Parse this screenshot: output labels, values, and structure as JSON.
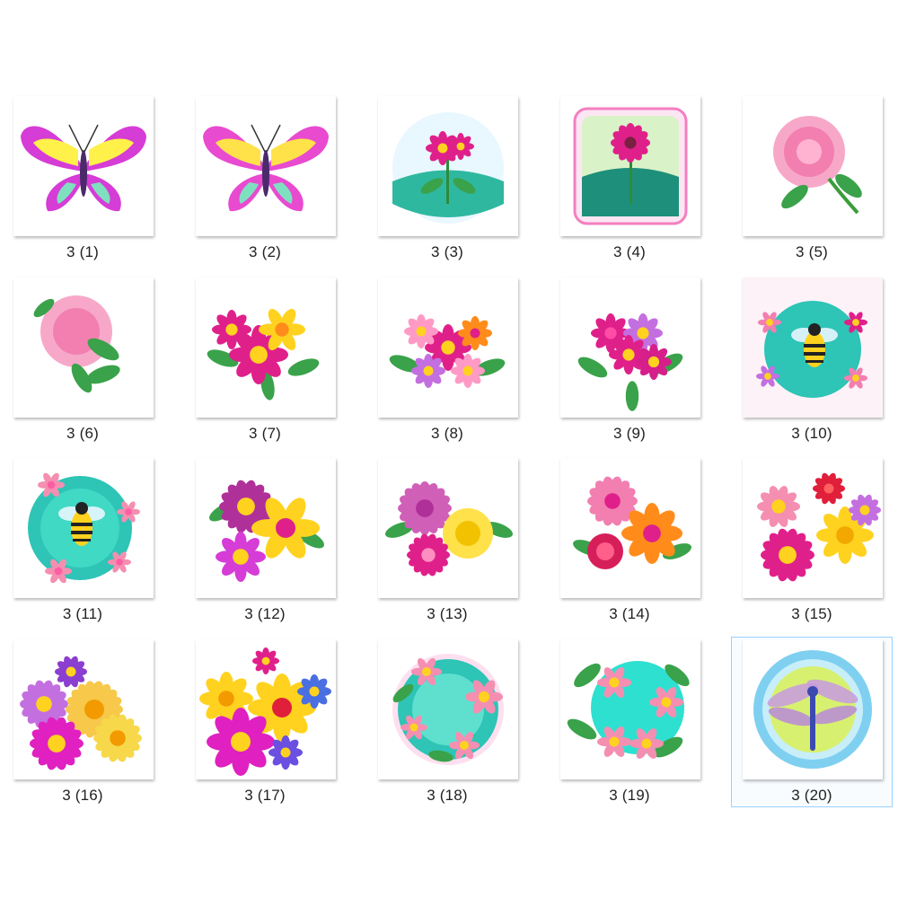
{
  "items": [
    {
      "label": "3 (1)",
      "icon": "butterfly-icon"
    },
    {
      "label": "3 (2)",
      "icon": "butterfly-icon"
    },
    {
      "label": "3 (3)",
      "icon": "flower-landscape-icon"
    },
    {
      "label": "3 (4)",
      "icon": "single-flower-icon"
    },
    {
      "label": "3 (5)",
      "icon": "peony-icon"
    },
    {
      "label": "3 (6)",
      "icon": "peony-icon"
    },
    {
      "label": "3 (7)",
      "icon": "flower-bouquet-icon"
    },
    {
      "label": "3 (8)",
      "icon": "flower-bouquet-icon"
    },
    {
      "label": "3 (9)",
      "icon": "flower-bouquet-icon"
    },
    {
      "label": "3 (10)",
      "icon": "bee-wreath-icon"
    },
    {
      "label": "3 (11)",
      "icon": "bee-wreath-icon"
    },
    {
      "label": "3 (12)",
      "icon": "flower-bouquet-icon"
    },
    {
      "label": "3 (13)",
      "icon": "rose-bouquet-icon"
    },
    {
      "label": "3 (14)",
      "icon": "rose-bouquet-icon"
    },
    {
      "label": "3 (15)",
      "icon": "flower-bouquet-icon"
    },
    {
      "label": "3 (16)",
      "icon": "daisy-bouquet-icon"
    },
    {
      "label": "3 (17)",
      "icon": "flower-bouquet-icon"
    },
    {
      "label": "3 (18)",
      "icon": "flower-wreath-icon"
    },
    {
      "label": "3 (19)",
      "icon": "flower-wreath-icon"
    },
    {
      "label": "3 (20)",
      "icon": "dragonfly-icon"
    }
  ],
  "selected_index": 19,
  "colors": {
    "selection_border": "#99d1ff",
    "magenta": "#e91e8c",
    "pink": "#f48fb1",
    "yellow": "#ffe14d",
    "teal": "#2ec4b6",
    "green": "#3a9d3a"
  }
}
